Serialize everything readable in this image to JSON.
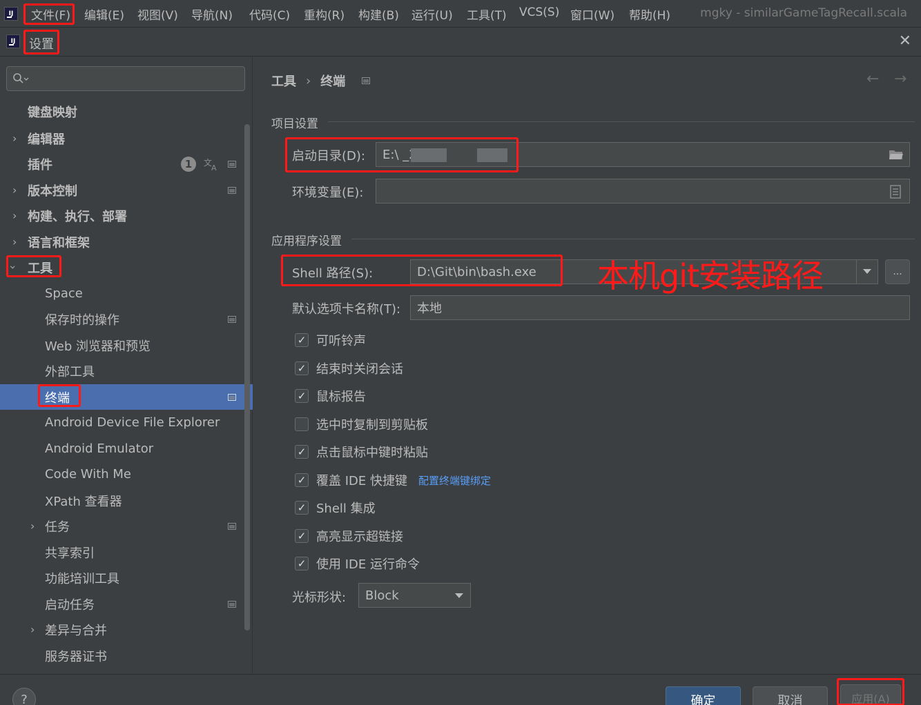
{
  "menubar": {
    "items": [
      "文件(F)",
      "编辑(E)",
      "视图(V)",
      "导航(N)",
      "代码(C)",
      "重构(R)",
      "构建(B)",
      "运行(U)",
      "工具(T)",
      "VCS(S)",
      "窗口(W)",
      "帮助(H)"
    ],
    "window_title": "mgky - similarGameTagRecall.scala"
  },
  "dialog": {
    "title": "设置",
    "close_glyph": "✕"
  },
  "sidebar": {
    "search_placeholder": "",
    "plugin_badge": "1",
    "items": [
      {
        "label": "键盘映射"
      },
      {
        "label": "编辑器"
      },
      {
        "label": "插件"
      },
      {
        "label": "版本控制"
      },
      {
        "label": "构建、执行、部署"
      },
      {
        "label": "语言和框架"
      },
      {
        "label": "工具"
      },
      {
        "label": "Space"
      },
      {
        "label": "保存时的操作"
      },
      {
        "label": "Web 浏览器和预览"
      },
      {
        "label": "外部工具"
      },
      {
        "label": "终端"
      },
      {
        "label": "Android Device File Explorer"
      },
      {
        "label": "Android Emulator"
      },
      {
        "label": "Code With Me"
      },
      {
        "label": "XPath 查看器"
      },
      {
        "label": "任务"
      },
      {
        "label": "共享索引"
      },
      {
        "label": "功能培训工具"
      },
      {
        "label": "启动任务"
      },
      {
        "label": "差异与合并"
      },
      {
        "label": "服务器证书"
      }
    ]
  },
  "breadcrumb": {
    "parent": "工具",
    "separator": "›",
    "current": "终端",
    "back_glyph": "←",
    "forward_glyph": "→"
  },
  "project_settings": {
    "title": "项目设置",
    "start_dir_label": "启动目录(D):",
    "start_dir_value": "E:\\       _2022\\",
    "env_label": "环境变量(E):",
    "env_value": ""
  },
  "app_settings": {
    "title": "应用程序设置",
    "shell_path_label": "Shell 路径(S):",
    "shell_path_value": "D:\\Git\\bin\\bash.exe",
    "annotation": "本机git安装路径",
    "browse_label": "...",
    "tab_name_label": "默认选项卡名称(T):",
    "tab_name_value": "本地",
    "checkboxes": [
      {
        "label": "可听铃声",
        "checked": "✓"
      },
      {
        "label": "结束时关闭会话",
        "checked": "✓"
      },
      {
        "label": "鼠标报告",
        "checked": "✓"
      },
      {
        "label": "选中时复制到剪贴板",
        "checked": ""
      },
      {
        "label": "点击鼠标中键时粘贴",
        "checked": "✓"
      },
      {
        "label": "覆盖 IDE 快捷键",
        "checked": "✓"
      },
      {
        "label": "Shell 集成",
        "checked": "✓"
      },
      {
        "label": "高亮显示超链接",
        "checked": "✓"
      },
      {
        "label": "使用 IDE 运行命令",
        "checked": "✓"
      }
    ],
    "keybinding_link": "配置终端键绑定",
    "cursor_label": "光标形状:",
    "cursor_value": "Block"
  },
  "footer": {
    "help_label": "?",
    "ok_label": "确定",
    "cancel_label": "取消",
    "apply_label": "应用(A)"
  }
}
